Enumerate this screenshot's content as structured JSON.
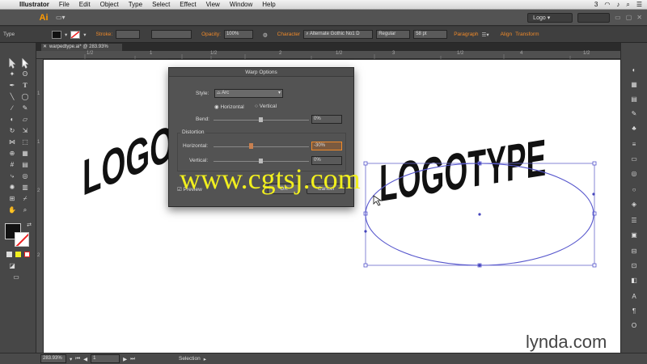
{
  "menubar": {
    "app": "Illustrator",
    "items": [
      "File",
      "Edit",
      "Object",
      "Type",
      "Select",
      "Effect",
      "View",
      "Window",
      "Help"
    ],
    "workspace": "Logo",
    "badge": "3"
  },
  "control": {
    "tool_label": "Type",
    "stroke_label": "Stroke:",
    "opacity_label": "Opacity:",
    "opacity_value": "100%",
    "character_label": "Character",
    "font_name": "Alternate Gothic No1 D",
    "font_style": "Regular",
    "font_size": "58 pt",
    "paragraph_label": "Paragraph",
    "align_label": "Align",
    "transform_label": "Transform"
  },
  "document": {
    "tab_title": "warpedtype.ai* @ 283.93% (RGB/Preview)"
  },
  "rulers": {
    "h_marks": [
      "0",
      "1/2",
      "1",
      "1/2",
      "2",
      "1/2",
      "3",
      "1/2",
      "4",
      "1/2"
    ],
    "v_marks": [
      "1",
      "1",
      "2",
      "2"
    ]
  },
  "canvas": {
    "left_text": "LOGO",
    "right_text": "LOGOTYPE"
  },
  "dialog": {
    "title": "Warp Options",
    "style_label": "Style:",
    "style_value": "Arc",
    "horizontal_label": "Horizontal",
    "vertical_label": "Vertical",
    "bend_label": "Bend:",
    "bend_value": "0%",
    "distortion_label": "Distortion",
    "dist_h_label": "Horizontal:",
    "dist_h_value": "-30%",
    "dist_v_label": "Vertical:",
    "dist_v_value": "0%",
    "preview_label": "Preview",
    "ok_label": "OK",
    "cancel_label": "Cancel"
  },
  "statusbar": {
    "zoom": "283.93%",
    "artboard": "1",
    "status": "Selection"
  },
  "overlays": {
    "watermark": "www.cgtsj.com",
    "brand": "lynda.com"
  },
  "colors": {
    "warp_path": "#5555cc",
    "accent": "#f08a2a",
    "watermark": "#f1ef1e"
  }
}
